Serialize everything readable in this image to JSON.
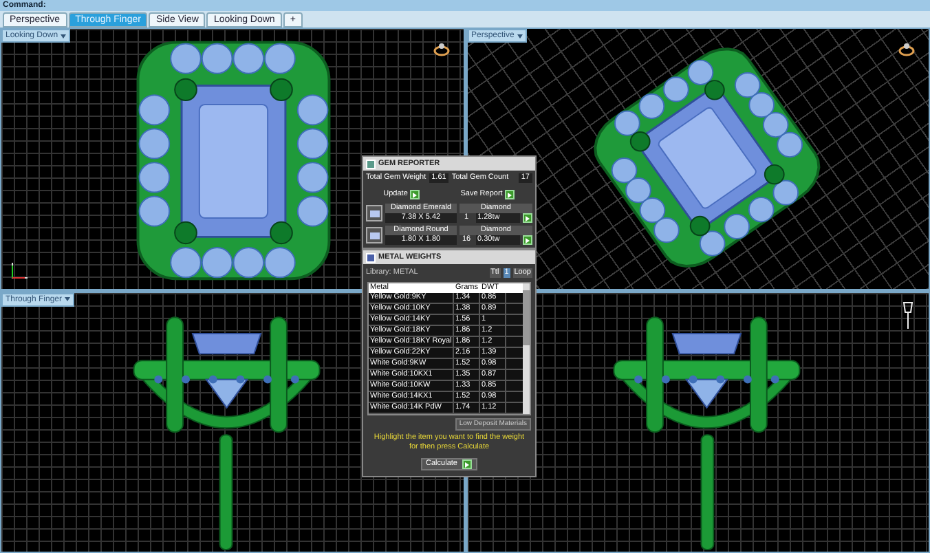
{
  "command_bar": {
    "label": "Command:"
  },
  "tabs": [
    {
      "label": "Perspective",
      "selected": false
    },
    {
      "label": "Through Finger",
      "selected": true
    },
    {
      "label": "Side View",
      "selected": false
    },
    {
      "label": "Looking Down",
      "selected": false
    },
    {
      "label": "+",
      "selected": false
    }
  ],
  "viewports": [
    {
      "label": "Looking Down",
      "kind": "top"
    },
    {
      "label": "Perspective",
      "kind": "persp"
    },
    {
      "label": "Through Finger",
      "kind": "front"
    },
    {
      "kind": "side"
    }
  ],
  "gem_reporter": {
    "title": "GEM REPORTER",
    "weight_label": "Total Gem Weight",
    "weight": "1.61",
    "count_label": "Total Gem Count",
    "count": "17",
    "update": "Update",
    "save": "Save Report",
    "gems": [
      {
        "name": "Diamond Emerald",
        "size": "7.38 X 5.42",
        "material": "Diamond",
        "count": "1",
        "weight": "1.28tw"
      },
      {
        "name": "Diamond Round",
        "size": "1.80 X 1.80",
        "material": "Diamond",
        "count": "16",
        "weight": "0.30tw"
      }
    ]
  },
  "metal_weights": {
    "title": "METAL WEIGHTS",
    "library": "Library: METAL",
    "unit": "Ttl",
    "quantity": "1",
    "mode": "Loop",
    "columns": [
      "Metal",
      "Grams",
      "DWT"
    ],
    "rows": [
      [
        "Yellow Gold:9KY",
        "1.34",
        "0.86"
      ],
      [
        "Yellow Gold:10KY",
        "1.38",
        "0.89"
      ],
      [
        "Yellow Gold:14KY",
        "1.56",
        "1"
      ],
      [
        "Yellow Gold:18KY",
        "1.86",
        "1.2"
      ],
      [
        "Yellow Gold:18KY Royal",
        "1.86",
        "1.2"
      ],
      [
        "Yellow Gold:22KY",
        "2.16",
        "1.39"
      ],
      [
        "White Gold:9KW",
        "1.52",
        "0.98"
      ],
      [
        "White Gold:10KX1",
        "1.35",
        "0.87"
      ],
      [
        "White Gold:10KW",
        "1.33",
        "0.85"
      ],
      [
        "White Gold:14KX1",
        "1.52",
        "0.98"
      ],
      [
        "White Gold:14K PdW",
        "1.74",
        "1.12"
      ]
    ],
    "low_deposit": "Low Deposit Materials",
    "hint": "Highlight the item you want to find the weight for then press Calculate",
    "calculate": "Calculate"
  }
}
